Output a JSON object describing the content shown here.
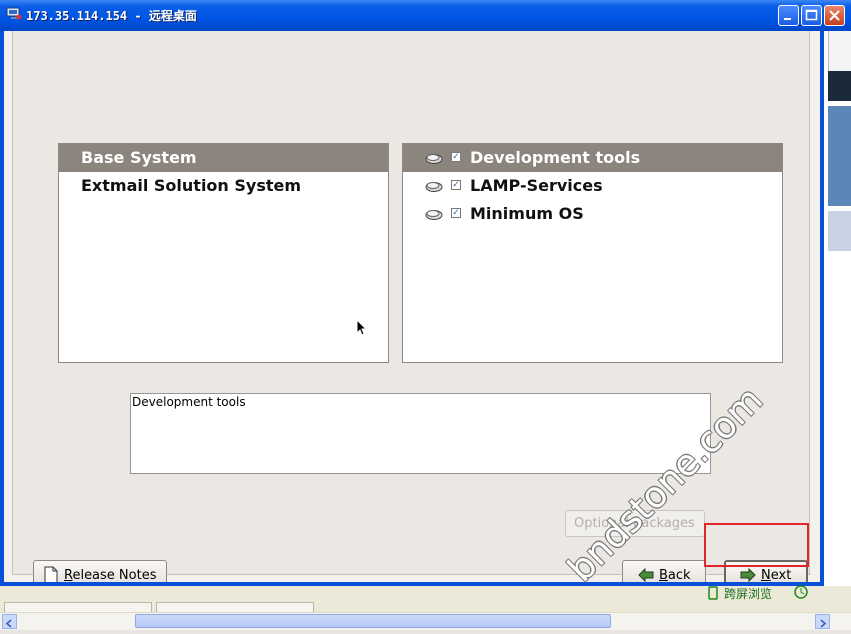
{
  "window": {
    "title": "173.35.114.154 - 远程桌面"
  },
  "groups": {
    "left": [
      {
        "label": "Base System",
        "selected": true
      },
      {
        "label": "Extmail Solution System",
        "selected": false
      }
    ],
    "right": [
      {
        "label": "Development tools",
        "checked": true,
        "selected": true
      },
      {
        "label": "LAMP-Services",
        "checked": true,
        "selected": false
      },
      {
        "label": "Minimum OS",
        "checked": true,
        "selected": false
      }
    ]
  },
  "description": "Development tools",
  "buttons": {
    "optional_packages": "Optional packages",
    "release_notes": "Release Notes",
    "release_notes_mnemonic": "R",
    "release_notes_rest": "elease Notes",
    "back": "Back",
    "back_mnemonic": "B",
    "back_rest": "ack",
    "next": "Next",
    "next_mnemonic": "N",
    "next_rest": "ext"
  },
  "watermark": "bndstone.com",
  "status": {
    "remote_browse": "跨屏浏览"
  },
  "colors": {
    "titlebar": "#0055e5",
    "selection": "#8b857d",
    "highlight_box": "#e0262b"
  }
}
